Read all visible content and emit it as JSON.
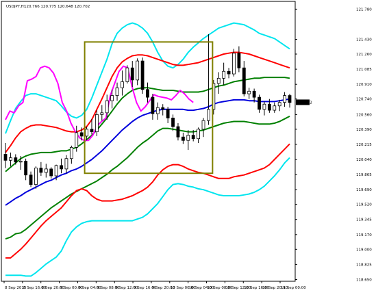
{
  "header": {
    "symbol_label": "USDJPY,H1",
    "ohlc_text": "120.766 120.775 120.648 120.702"
  },
  "chart_data": {
    "type": "candlestick",
    "symbol": "USDJPY",
    "timeframe": "H1",
    "ylim": [
      118.63,
      121.87
    ],
    "y_ticks": [
      "121.780",
      "121.430",
      "121.260",
      "121.085",
      "120.910",
      "120.740",
      "120.560",
      "120.390",
      "120.215",
      "120.040",
      "119.865",
      "119.690",
      "119.520",
      "119.345",
      "119.170",
      "119.000",
      "118.825",
      "118.650"
    ],
    "x_labels": [
      "8 Sep 2015",
      "8 Sep 16:00",
      "8 Sep 20:00",
      "9 Sep 00:00",
      "9 Sep 04:00",
      "9 Sep 08:00",
      "9 Sep 12:00",
      "9 Sep 16:00",
      "9 Sep 20:00",
      "10 Sep 00:00",
      "10 Sep 04:00",
      "10 Sep 08:00",
      "10 Sep 12:00",
      "10 Sep 16:00",
      "10 Sep 20:00",
      "11 Sep 00:00"
    ],
    "current_price": "120.702",
    "candles": [
      {
        "o": 120.1,
        "h": 120.23,
        "l": 119.94,
        "c": 120.03
      },
      {
        "o": 120.03,
        "h": 120.12,
        "l": 119.96,
        "c": 120.06
      },
      {
        "o": 120.06,
        "h": 120.1,
        "l": 119.98,
        "c": 120.01
      },
      {
        "o": 120.01,
        "h": 120.08,
        "l": 119.92,
        "c": 120.02
      },
      {
        "o": 120.02,
        "h": 120.05,
        "l": 119.8,
        "c": 119.86
      },
      {
        "o": 119.86,
        "h": 119.9,
        "l": 119.72,
        "c": 119.75
      },
      {
        "o": 119.75,
        "h": 119.96,
        "l": 119.7,
        "c": 119.94
      },
      {
        "o": 119.94,
        "h": 120.01,
        "l": 119.85,
        "c": 119.89
      },
      {
        "o": 119.89,
        "h": 119.99,
        "l": 119.83,
        "c": 119.93
      },
      {
        "o": 119.93,
        "h": 119.95,
        "l": 119.82,
        "c": 119.85
      },
      {
        "o": 119.85,
        "h": 119.98,
        "l": 119.8,
        "c": 119.97
      },
      {
        "o": 119.97,
        "h": 120.05,
        "l": 119.88,
        "c": 119.93
      },
      {
        "o": 119.93,
        "h": 120.09,
        "l": 119.88,
        "c": 120.05
      },
      {
        "o": 120.05,
        "h": 120.2,
        "l": 119.99,
        "c": 120.18
      },
      {
        "o": 120.18,
        "h": 120.43,
        "l": 120.13,
        "c": 120.35
      },
      {
        "o": 120.35,
        "h": 120.41,
        "l": 120.26,
        "c": 120.31
      },
      {
        "o": 120.31,
        "h": 120.42,
        "l": 120.26,
        "c": 120.39
      },
      {
        "o": 120.39,
        "h": 120.51,
        "l": 120.33,
        "c": 120.36
      },
      {
        "o": 120.36,
        "h": 120.61,
        "l": 120.31,
        "c": 120.56
      },
      {
        "o": 120.56,
        "h": 120.67,
        "l": 120.49,
        "c": 120.58
      },
      {
        "o": 120.58,
        "h": 120.79,
        "l": 120.5,
        "c": 120.72
      },
      {
        "o": 120.72,
        "h": 120.85,
        "l": 120.63,
        "c": 120.78
      },
      {
        "o": 120.78,
        "h": 120.93,
        "l": 120.72,
        "c": 120.87
      },
      {
        "o": 120.87,
        "h": 121.07,
        "l": 120.78,
        "c": 120.94
      },
      {
        "o": 120.94,
        "h": 121.13,
        "l": 120.92,
        "c": 121.1
      },
      {
        "o": 121.1,
        "h": 121.18,
        "l": 120.88,
        "c": 120.96
      },
      {
        "o": 120.96,
        "h": 121.21,
        "l": 120.9,
        "c": 121.18
      },
      {
        "o": 121.18,
        "h": 121.22,
        "l": 120.8,
        "c": 120.85
      },
      {
        "o": 120.85,
        "h": 120.93,
        "l": 120.7,
        "c": 120.76
      },
      {
        "o": 120.76,
        "h": 120.8,
        "l": 120.5,
        "c": 120.57
      },
      {
        "o": 120.57,
        "h": 120.7,
        "l": 120.5,
        "c": 120.64
      },
      {
        "o": 120.64,
        "h": 120.68,
        "l": 120.55,
        "c": 120.62
      },
      {
        "o": 120.62,
        "h": 120.65,
        "l": 120.46,
        "c": 120.52
      },
      {
        "o": 120.52,
        "h": 120.56,
        "l": 120.37,
        "c": 120.42
      },
      {
        "o": 120.42,
        "h": 120.46,
        "l": 120.26,
        "c": 120.3
      },
      {
        "o": 120.3,
        "h": 120.35,
        "l": 120.22,
        "c": 120.26
      },
      {
        "o": 120.26,
        "h": 120.38,
        "l": 120.15,
        "c": 120.32
      },
      {
        "o": 120.32,
        "h": 120.38,
        "l": 120.25,
        "c": 120.28
      },
      {
        "o": 120.28,
        "h": 120.41,
        "l": 120.23,
        "c": 120.39
      },
      {
        "o": 120.39,
        "h": 120.52,
        "l": 120.3,
        "c": 120.49
      },
      {
        "o": 120.49,
        "h": 121.49,
        "l": 120.44,
        "c": 120.62
      },
      {
        "o": 120.62,
        "h": 120.96,
        "l": 120.56,
        "c": 120.92
      },
      {
        "o": 120.92,
        "h": 121.05,
        "l": 120.8,
        "c": 120.98
      },
      {
        "o": 120.98,
        "h": 121.16,
        "l": 120.9,
        "c": 121.06
      },
      {
        "o": 121.06,
        "h": 121.1,
        "l": 120.98,
        "c": 121.03
      },
      {
        "o": 121.03,
        "h": 121.32,
        "l": 121.0,
        "c": 121.27
      },
      {
        "o": 121.27,
        "h": 121.35,
        "l": 121.05,
        "c": 121.1
      },
      {
        "o": 121.1,
        "h": 121.18,
        "l": 120.77,
        "c": 120.8
      },
      {
        "o": 120.8,
        "h": 120.87,
        "l": 120.74,
        "c": 120.83
      },
      {
        "o": 120.83,
        "h": 120.86,
        "l": 120.7,
        "c": 120.76
      },
      {
        "o": 120.76,
        "h": 120.79,
        "l": 120.58,
        "c": 120.62
      },
      {
        "o": 120.62,
        "h": 120.71,
        "l": 120.55,
        "c": 120.68
      },
      {
        "o": 120.68,
        "h": 120.74,
        "l": 120.58,
        "c": 120.61
      },
      {
        "o": 120.61,
        "h": 120.7,
        "l": 120.58,
        "c": 120.66
      },
      {
        "o": 120.66,
        "h": 120.73,
        "l": 120.6,
        "c": 120.7
      },
      {
        "o": 120.7,
        "h": 120.82,
        "l": 120.65,
        "c": 120.78
      },
      {
        "o": 120.78,
        "h": 120.8,
        "l": 120.64,
        "c": 120.7
      }
    ],
    "series": [
      {
        "color": "#00e5ee",
        "values": [
          120.34,
          120.49,
          120.63,
          120.71,
          120.78,
          120.8,
          120.8,
          120.78,
          120.76,
          120.74,
          120.72,
          120.66,
          120.59,
          120.54,
          120.52,
          120.55,
          120.62,
          120.75,
          120.9,
          121.05,
          121.2,
          121.38,
          121.5,
          121.56,
          121.6,
          121.62,
          121.6,
          121.56,
          121.5,
          121.4,
          121.28,
          121.18,
          121.12,
          121.1,
          121.14,
          121.2,
          121.28,
          121.34,
          121.39,
          121.44,
          121.48,
          121.52,
          121.56,
          121.58,
          121.6,
          121.62,
          121.61,
          121.6,
          121.57,
          121.54,
          121.5,
          121.48,
          121.46,
          121.44,
          121.4,
          121.36,
          121.32
        ]
      },
      {
        "color": "#ff0000",
        "values": [
          120.12,
          120.2,
          120.29,
          120.36,
          120.4,
          120.43,
          120.44,
          120.44,
          120.43,
          120.42,
          120.41,
          120.39,
          120.37,
          120.36,
          120.36,
          120.38,
          120.42,
          120.5,
          120.62,
          120.74,
          120.87,
          121.0,
          121.1,
          121.17,
          121.21,
          121.24,
          121.25,
          121.25,
          121.24,
          121.22,
          121.2,
          121.18,
          121.16,
          121.14,
          121.13,
          121.13,
          121.14,
          121.15,
          121.16,
          121.18,
          121.2,
          121.22,
          121.24,
          121.26,
          121.27,
          121.28,
          121.28,
          121.27,
          121.26,
          121.24,
          121.22,
          121.2,
          121.18,
          121.16,
          121.14,
          121.12,
          121.1
        ]
      },
      {
        "color": "#008000",
        "values": [
          119.9,
          119.95,
          120.0,
          120.05,
          120.08,
          120.1,
          120.11,
          120.12,
          120.12,
          120.12,
          120.13,
          120.14,
          120.14,
          120.16,
          120.18,
          120.22,
          120.27,
          120.32,
          120.38,
          120.45,
          120.52,
          120.6,
          120.68,
          120.75,
          120.8,
          120.84,
          120.86,
          120.87,
          120.87,
          120.86,
          120.85,
          120.84,
          120.84,
          120.84,
          120.83,
          120.82,
          120.82,
          120.82,
          120.82,
          120.83,
          120.85,
          120.87,
          120.89,
          120.9,
          120.92,
          120.94,
          120.95,
          120.96,
          120.97,
          120.98,
          120.98,
          120.99,
          120.99,
          120.99,
          120.99,
          120.99,
          120.98
        ]
      },
      {
        "color": "#0000dd",
        "values": [
          119.51,
          119.55,
          119.59,
          119.62,
          119.66,
          119.69,
          119.72,
          119.75,
          119.78,
          119.8,
          119.83,
          119.86,
          119.88,
          119.91,
          119.93,
          119.96,
          120.0,
          120.04,
          120.09,
          120.14,
          120.2,
          120.26,
          120.32,
          120.38,
          120.43,
          120.48,
          120.52,
          120.55,
          120.57,
          120.59,
          120.61,
          120.62,
          120.62,
          120.62,
          120.62,
          120.62,
          120.61,
          120.61,
          120.62,
          120.63,
          120.65,
          120.68,
          120.7,
          120.71,
          120.72,
          120.73,
          120.73,
          120.73,
          120.72,
          120.72,
          120.71,
          120.71,
          120.71,
          120.71,
          120.72,
          120.73,
          120.74
        ]
      },
      {
        "color": "#008000",
        "values": [
          119.12,
          119.14,
          119.18,
          119.19,
          119.23,
          119.28,
          119.33,
          119.38,
          119.43,
          119.48,
          119.52,
          119.56,
          119.6,
          119.64,
          119.67,
          119.7,
          119.73,
          119.76,
          119.79,
          119.83,
          119.87,
          119.92,
          119.96,
          120.01,
          120.06,
          120.12,
          120.18,
          120.23,
          120.27,
          120.32,
          120.37,
          120.4,
          120.4,
          120.39,
          120.38,
          120.37,
          120.36,
          120.36,
          120.37,
          120.38,
          120.4,
          120.42,
          120.44,
          120.46,
          120.47,
          120.48,
          120.48,
          120.48,
          120.47,
          120.46,
          120.45,
          120.45,
          120.45,
          120.46,
          120.48,
          120.51,
          120.54
        ]
      },
      {
        "color": "#ff0000",
        "values": [
          118.9,
          118.9,
          118.95,
          119.0,
          119.06,
          119.13,
          119.2,
          119.27,
          119.33,
          119.38,
          119.43,
          119.48,
          119.55,
          119.62,
          119.68,
          119.7,
          119.68,
          119.62,
          119.58,
          119.56,
          119.56,
          119.56,
          119.57,
          119.58,
          119.6,
          119.62,
          119.65,
          119.68,
          119.72,
          119.78,
          119.86,
          119.92,
          119.96,
          119.98,
          119.98,
          119.96,
          119.93,
          119.91,
          119.89,
          119.88,
          119.86,
          119.84,
          119.82,
          119.82,
          119.82,
          119.84,
          119.85,
          119.86,
          119.88,
          119.9,
          119.92,
          119.94,
          119.98,
          120.04,
          120.1,
          120.16,
          120.22
        ]
      },
      {
        "color": "#00e5ee",
        "values": [
          118.7,
          118.7,
          118.7,
          118.7,
          118.69,
          118.69,
          118.73,
          118.78,
          118.83,
          118.87,
          118.91,
          118.98,
          119.1,
          119.2,
          119.26,
          119.3,
          119.32,
          119.33,
          119.33,
          119.33,
          119.33,
          119.33,
          119.33,
          119.33,
          119.33,
          119.33,
          119.35,
          119.37,
          119.41,
          119.47,
          119.53,
          119.61,
          119.69,
          119.75,
          119.76,
          119.75,
          119.73,
          119.72,
          119.7,
          119.69,
          119.67,
          119.65,
          119.63,
          119.62,
          119.62,
          119.62,
          119.62,
          119.63,
          119.64,
          119.66,
          119.69,
          119.73,
          119.79,
          119.85,
          119.92,
          120.0,
          120.06
        ]
      },
      {
        "color": "#ff00ff",
        "x_range": [
          0,
          37
        ],
        "values": [
          120.5,
          120.6,
          120.58,
          120.66,
          120.7,
          120.95,
          120.97,
          121.0,
          121.1,
          121.12,
          121.1,
          121.04,
          120.92,
          120.7,
          120.6,
          120.46,
          120.36,
          120.29,
          120.26,
          120.26,
          120.32,
          120.43,
          120.48,
          120.52,
          120.78,
          120.92,
          121.06,
          121.12,
          121.1,
          120.88,
          120.7,
          120.6,
          120.65,
          120.72,
          120.79,
          120.77,
          120.76,
          120.75,
          120.73,
          120.78,
          120.84,
          120.8,
          120.74,
          120.7
        ]
      }
    ],
    "annotation_box": {
      "x_range": [
        15.6,
        40.8
      ],
      "y_range": [
        119.88,
        121.4
      ],
      "color": "#808000"
    }
  }
}
